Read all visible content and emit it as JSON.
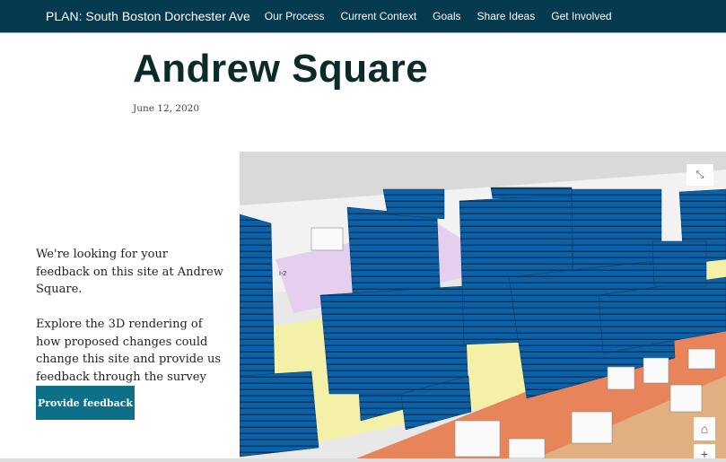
{
  "nav": {
    "brand": "PLAN: South Boston Dorchester Ave",
    "items": [
      "Our Process",
      "Current Context",
      "Goals",
      "Share Ideas",
      "Get Involved"
    ]
  },
  "page": {
    "title": "Andrew Square",
    "date": "June 12, 2020"
  },
  "intro": {
    "p1": "We're looking for your feedback on this site at Andrew Square.",
    "p2": "Explore the 3D rendering of how proposed changes could change this site and provide us feedback through the survey below."
  },
  "cta": {
    "label": "Provide feedback"
  },
  "scene": {
    "label": "I-2",
    "icons": [
      "fullscreen-icon",
      "home-icon",
      "zoom-in-icon"
    ]
  },
  "colors": {
    "nav": "#053a4f",
    "button": "#0e7088",
    "building": "#0b62a8"
  }
}
